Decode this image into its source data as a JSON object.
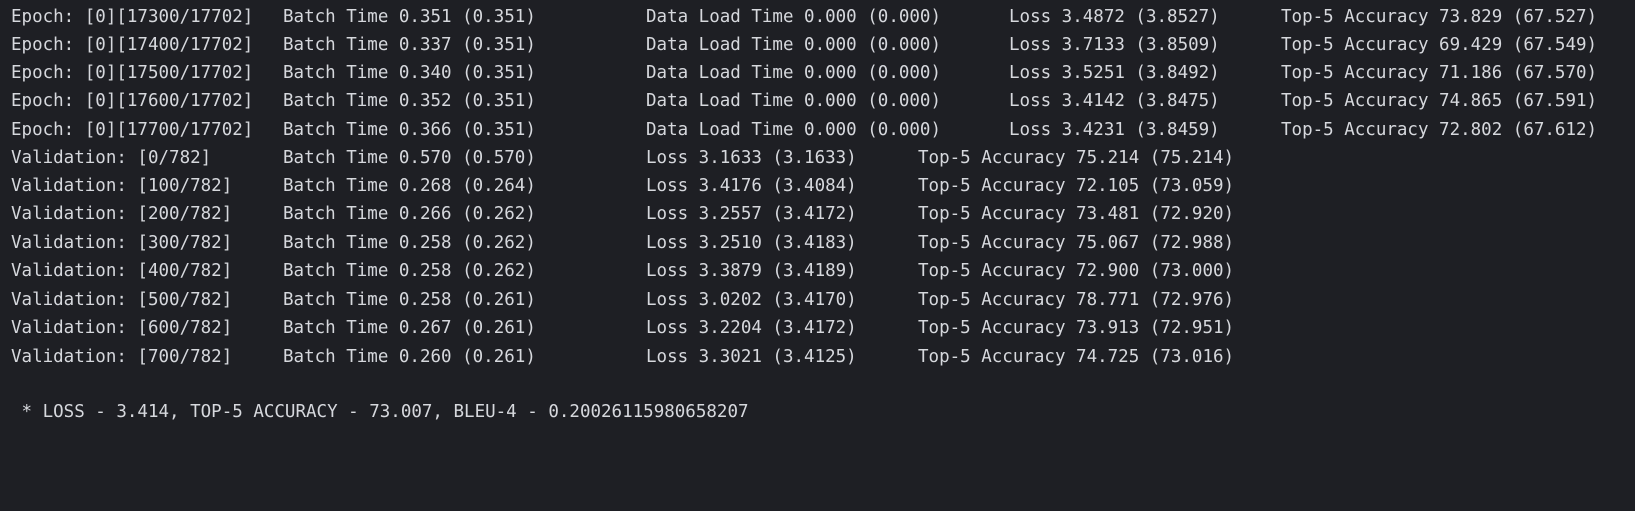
{
  "training_lines": [
    {
      "epoch": "Epoch: [0][17300/17702]",
      "batch_time": "Batch Time 0.351 (0.351)",
      "data_load": "Data Load Time 0.000 (0.000)",
      "loss": "Loss 3.4872 (3.8527)",
      "top5": "Top-5 Accuracy 73.829 (67.527)"
    },
    {
      "epoch": "Epoch: [0][17400/17702]",
      "batch_time": "Batch Time 0.337 (0.351)",
      "data_load": "Data Load Time 0.000 (0.000)",
      "loss": "Loss 3.7133 (3.8509)",
      "top5": "Top-5 Accuracy 69.429 (67.549)"
    },
    {
      "epoch": "Epoch: [0][17500/17702]",
      "batch_time": "Batch Time 0.340 (0.351)",
      "data_load": "Data Load Time 0.000 (0.000)",
      "loss": "Loss 3.5251 (3.8492)",
      "top5": "Top-5 Accuracy 71.186 (67.570)"
    },
    {
      "epoch": "Epoch: [0][17600/17702]",
      "batch_time": "Batch Time 0.352 (0.351)",
      "data_load": "Data Load Time 0.000 (0.000)",
      "loss": "Loss 3.4142 (3.8475)",
      "top5": "Top-5 Accuracy 74.865 (67.591)"
    },
    {
      "epoch": "Epoch: [0][17700/17702]",
      "batch_time": "Batch Time 0.366 (0.351)",
      "data_load": "Data Load Time 0.000 (0.000)",
      "loss": "Loss 3.4231 (3.8459)",
      "top5": "Top-5 Accuracy 72.802 (67.612)"
    }
  ],
  "validation_lines": [
    {
      "step": "Validation: [0/782]",
      "batch_time": "Batch Time 0.570 (0.570)",
      "loss": "Loss 3.1633 (3.1633)",
      "top5": "Top-5 Accuracy 75.214 (75.214)"
    },
    {
      "step": "Validation: [100/782]",
      "batch_time": "Batch Time 0.268 (0.264)",
      "loss": "Loss 3.4176 (3.4084)",
      "top5": "Top-5 Accuracy 72.105 (73.059)"
    },
    {
      "step": "Validation: [200/782]",
      "batch_time": "Batch Time 0.266 (0.262)",
      "loss": "Loss 3.2557 (3.4172)",
      "top5": "Top-5 Accuracy 73.481 (72.920)"
    },
    {
      "step": "Validation: [300/782]",
      "batch_time": "Batch Time 0.258 (0.262)",
      "loss": "Loss 3.2510 (3.4183)",
      "top5": "Top-5 Accuracy 75.067 (72.988)"
    },
    {
      "step": "Validation: [400/782]",
      "batch_time": "Batch Time 0.258 (0.262)",
      "loss": "Loss 3.3879 (3.4189)",
      "top5": "Top-5 Accuracy 72.900 (73.000)"
    },
    {
      "step": "Validation: [500/782]",
      "batch_time": "Batch Time 0.258 (0.261)",
      "loss": "Loss 3.0202 (3.4170)",
      "top5": "Top-5 Accuracy 78.771 (72.976)"
    },
    {
      "step": "Validation: [600/782]",
      "batch_time": "Batch Time 0.267 (0.261)",
      "loss": "Loss 3.2204 (3.4172)",
      "top5": "Top-5 Accuracy 73.913 (72.951)"
    },
    {
      "step": "Validation: [700/782]",
      "batch_time": "Batch Time 0.260 (0.261)",
      "loss": "Loss 3.3021 (3.4125)",
      "top5": "Top-5 Accuracy 74.725 (73.016)"
    }
  ],
  "summary": " * LOSS - 3.414, TOP-5 ACCURACY - 73.007, BLEU-4 - 0.20026115980658207",
  "colors": {
    "background": "#1e1f24",
    "text": "#d6d8dd"
  }
}
